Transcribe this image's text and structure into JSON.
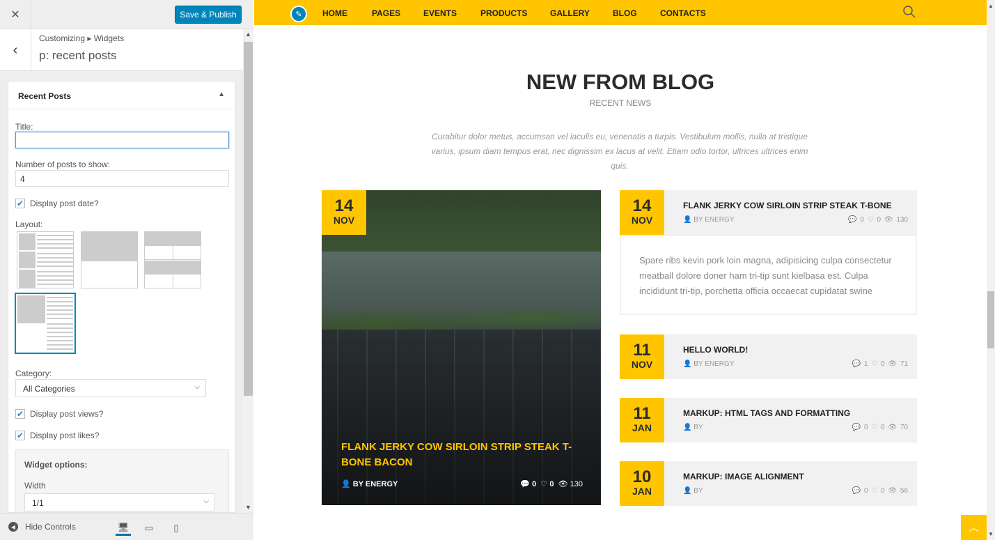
{
  "customizer": {
    "close_icon": "close-icon",
    "save_label": "Save & Publish",
    "breadcrumb": "Customizing ▸ Widgets",
    "section_name": "p: recent posts",
    "widget": {
      "title": "Recent Posts",
      "title_label": "Title:",
      "title_value": "",
      "count_label": "Number of posts to show:",
      "count_value": "4",
      "show_date_label": "Display post date?",
      "show_date": true,
      "layout_label": "Layout:",
      "selected_layout": 4,
      "category_label": "Category:",
      "category_value": "All Categories",
      "show_views_label": "Display post views?",
      "show_views": true,
      "show_likes_label": "Display post likes?",
      "show_likes": true,
      "options_title": "Widget options:",
      "width_label": "Width",
      "width_value": "1/1"
    },
    "footer": {
      "hide_label": "Hide Controls"
    }
  },
  "preview": {
    "nav": [
      "HOME",
      "PAGES",
      "EVENTS",
      "PRODUCTS",
      "GALLERY",
      "BLOG",
      "CONTACTS"
    ],
    "heading": "NEW FROM BLOG",
    "subheading": "RECENT NEWS",
    "intro": "Curabitur dolor metus, accumsan vel iaculis eu, venenatis a turpis. Vestibulum mollis, nulla at tristique varius, ipsum diam tempus erat, nec dignissim ex lacus at velit. Etiam odio tortor, ultrices ultrices enim quis.",
    "featured": {
      "day": "14",
      "month": "NOV",
      "title": "FLANK JERKY COW SIRLOIN STRIP STEAK T-BONE BACON",
      "author": "BY ENERGY",
      "comments": "0",
      "likes": "0",
      "views": "130"
    },
    "posts": [
      {
        "day": "14",
        "month": "NOV",
        "title": "FLANK JERKY COW SIRLOIN STRIP STEAK T-BONE",
        "author": "BY ENERGY",
        "comments": "0",
        "likes": "0",
        "views": "130"
      },
      {
        "day": "11",
        "month": "NOV",
        "title": "HELLO WORLD!",
        "author": "BY ENERGY",
        "comments": "1",
        "likes": "0",
        "views": "71"
      },
      {
        "day": "11",
        "month": "JAN",
        "title": "MARKUP: HTML TAGS AND FORMATTING",
        "author": "BY",
        "comments": "0",
        "likes": "0",
        "views": "70"
      },
      {
        "day": "10",
        "month": "JAN",
        "title": "MARKUP: IMAGE ALIGNMENT",
        "author": "BY",
        "comments": "0",
        "likes": "0",
        "views": "56"
      }
    ],
    "excerpt": "Spare ribs kevin pork loin magna, adipisicing culpa consectetur meatball dolore doner ham tri-tip sunt kielbasa est. Culpa incididunt tri-tip, porchetta officia occaecat cupidatat swine"
  },
  "colors": {
    "accent": "#ffc600",
    "wp_blue": "#0085ba"
  }
}
